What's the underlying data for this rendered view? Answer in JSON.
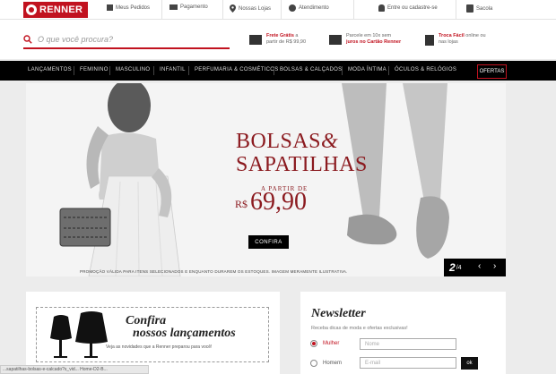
{
  "topbar": {
    "logo": "RENNER",
    "links": [
      {
        "label": "Meus Pedidos",
        "icon": "orders-icon"
      },
      {
        "label": "Pagamento",
        "icon": "card-icon"
      },
      {
        "label": "Nossas Lojas",
        "icon": "pin-icon"
      },
      {
        "label": "Atendimento",
        "icon": "chat-icon"
      },
      {
        "label": "Entre ou cadastre-se",
        "icon": "user-icon"
      },
      {
        "label": "Sacola",
        "icon": "bag-icon"
      }
    ]
  },
  "search": {
    "placeholder": "O que você procura?"
  },
  "promos": [
    {
      "highlight": "Frete Grátis",
      "line1": "a",
      "line2": "partir de R$ 99,90",
      "icon": "truck-icon"
    },
    {
      "highlight": "",
      "line1": "Parcele em 10x sem",
      "line2": "juros no Cartão Renner",
      "icon": "card-icon"
    },
    {
      "highlight": "Troca Fácil",
      "line1": "online ou",
      "line2": "nas lojas",
      "icon": "bag-icon"
    }
  ],
  "nav": {
    "items": [
      "LANÇAMENTOS",
      "FEMININO",
      "MASCULINO",
      "INFANTIL",
      "PERFUMARIA & COSMÉTICOS",
      "BOLSAS & CALÇADOS",
      "MODA ÍNTIMA",
      "ÓCULOS & RELÓGIOS"
    ],
    "offers": "OFERTAS"
  },
  "hero": {
    "title_line1": "BOLSAS",
    "amp": "&",
    "title_line2": "SAPATILHAS",
    "apartir": "A PARTIR DE",
    "currency": "R$",
    "price": "69,90",
    "cta": "CONFIRA",
    "disclaimer": "PROMOÇÃO VÁLIDA PARA ITENS SELECIONADOS E ENQUANTO DURAREM OS ESTOQUES. IMAGEM MERAMENTE ILUSTRATIVA.",
    "slide_current": "2",
    "slide_total": "/4"
  },
  "launches": {
    "title1": "Confira",
    "title2": "nossos lançamentos",
    "subtitle": "Veja as novidades que a Renner preparou para você!"
  },
  "newsletter": {
    "title": "Newsletter",
    "subtitle": "Receba dicas de moda e ofertas exclusivas!",
    "option_female": "Mulher",
    "option_male": "Homem",
    "name_placeholder": "Nome",
    "email_placeholder": "E-mail",
    "ok": "ok"
  },
  "statusbar": "...sapatilhas-bolsas-e-calcado?s_vid... Home-D2-B..."
}
